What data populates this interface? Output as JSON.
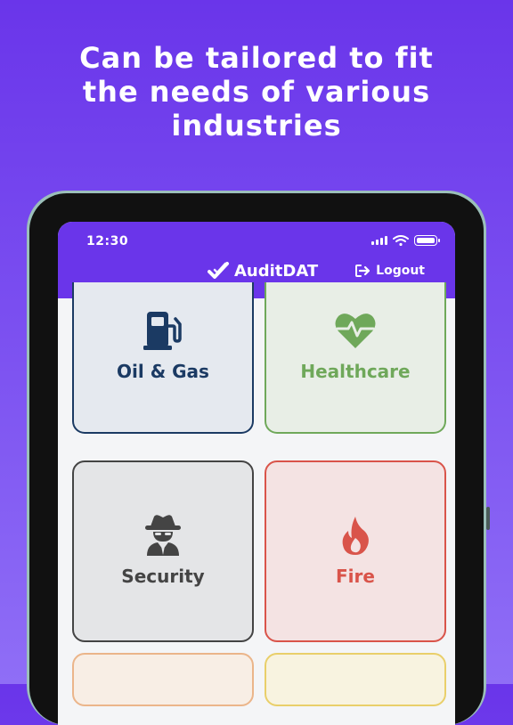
{
  "headline": [
    "Can be tailored to fit",
    "the needs of various",
    "industries"
  ],
  "status": {
    "time": "12:30"
  },
  "header": {
    "brand": "AuditDAT",
    "logout_label": "Logout"
  },
  "industries": [
    {
      "label": "Oil & Gas",
      "icon": "fuel-pump-icon",
      "color": "#1b3a63"
    },
    {
      "label": "Healthcare",
      "icon": "heart-pulse-icon",
      "color": "#6fa85a"
    },
    {
      "label": "Security",
      "icon": "spy-icon",
      "color": "#444444"
    },
    {
      "label": "Fire",
      "icon": "flame-icon",
      "color": "#d9544a"
    }
  ],
  "colors": {
    "accent": "#6a35ea"
  }
}
